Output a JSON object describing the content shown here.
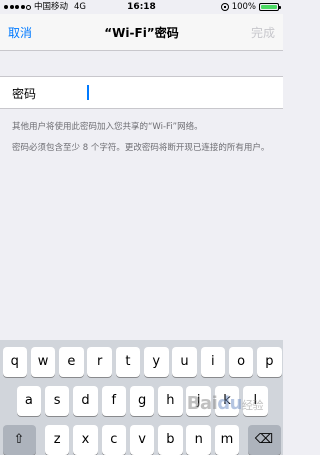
{
  "status_bar": {
    "carrier": "中国移动",
    "network": "4G",
    "time": "16:18",
    "battery_percent": "100%",
    "battery_level": 1.0
  },
  "nav": {
    "cancel_label": "取消",
    "title": "“Wi-Fi”密码",
    "done_label": "完成"
  },
  "form": {
    "password_label": "密码",
    "password_value": "",
    "hint_1": "其他用户将使用此密码加入您共享的“Wi-Fi”网络。",
    "hint_2": "密码必须包含至少 8 个字符。更改密码将断开现已连接的所有用户。"
  },
  "keyboard": {
    "row1": [
      "q",
      "w",
      "e",
      "r",
      "t",
      "y",
      "u",
      "i",
      "o",
      "p"
    ],
    "row2": [
      "a",
      "s",
      "d",
      "f",
      "g",
      "h",
      "j",
      "k",
      "l"
    ],
    "row3": [
      "z",
      "x",
      "c",
      "v",
      "b",
      "n",
      "m"
    ],
    "shift_icon": "⇧",
    "delete_icon": "⌫"
  },
  "watermark": {
    "text": "Bai",
    "paw": "du",
    "sub": "经验"
  },
  "colors": {
    "accent": "#007aff",
    "battery": "#4cd964",
    "disabled": "#c7c7cc"
  }
}
